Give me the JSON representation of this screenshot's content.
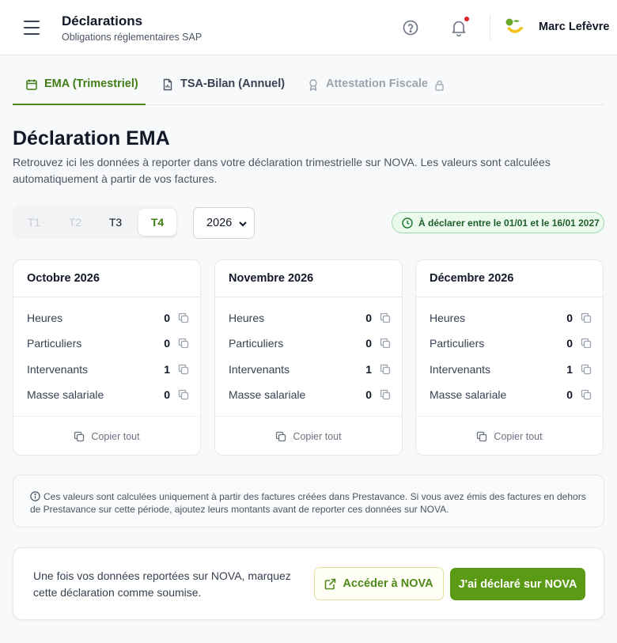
{
  "header": {
    "title": "Déclarations",
    "subtitle": "Obligations réglementaires SAP",
    "user_name": "Marc Lefèvre"
  },
  "tabs": [
    {
      "label": "EMA (Trimestriel)",
      "active": true,
      "icon": "calendar-icon"
    },
    {
      "label": "TSA-Bilan (Annuel)",
      "active": false,
      "icon": "document-icon"
    },
    {
      "label": "Attestation Fiscale",
      "active": false,
      "locked": true,
      "icon": "award-icon"
    }
  ],
  "page": {
    "title": "Déclaration EMA",
    "description": "Retrouvez ici les données à reporter dans votre déclaration trimestrielle sur NOVA. Les valeurs sont calculées automatiquement à partir de vos factures."
  },
  "quarters": {
    "options": [
      "T1",
      "T2",
      "T3",
      "T4"
    ],
    "selected": "T4"
  },
  "year_select": {
    "value": "2026"
  },
  "due_badge": {
    "text": "À déclarer entre le 01/01 et le 16/01 2027"
  },
  "months": [
    {
      "title": "Octobre 2026",
      "rows": [
        {
          "label": "Heures",
          "value": "0"
        },
        {
          "label": "Particuliers",
          "value": "0"
        },
        {
          "label": "Intervenants",
          "value": "1"
        },
        {
          "label": "Masse salariale",
          "value": "0"
        }
      ],
      "copy_all": "Copier tout"
    },
    {
      "title": "Novembre 2026",
      "rows": [
        {
          "label": "Heures",
          "value": "0"
        },
        {
          "label": "Particuliers",
          "value": "0"
        },
        {
          "label": "Intervenants",
          "value": "1"
        },
        {
          "label": "Masse salariale",
          "value": "0"
        }
      ],
      "copy_all": "Copier tout"
    },
    {
      "title": "Décembre 2026",
      "rows": [
        {
          "label": "Heures",
          "value": "0"
        },
        {
          "label": "Particuliers",
          "value": "0"
        },
        {
          "label": "Intervenants",
          "value": "1"
        },
        {
          "label": "Masse salariale",
          "value": "0"
        }
      ],
      "copy_all": "Copier tout"
    }
  ],
  "info": {
    "text": "Ces valeurs sont calculées uniquement à partir des factures créées dans Prestavance. Si vous avez émis des factures en dehors de Prestavance sur cette période, ajoutez leurs montants avant de reporter ces données sur NOVA."
  },
  "submit": {
    "text": "Une fois vos données reportées sur NOVA, marquez cette déclaration comme soumise.",
    "nova_button": "Accéder à NOVA",
    "declare_button": "J'ai déclaré sur NOVA"
  },
  "colors": {
    "accent": "#4d8a1a",
    "primary_button": "#5a9a14",
    "badge_bg": "#ecfaee",
    "notification_dot": "#dc2626"
  }
}
